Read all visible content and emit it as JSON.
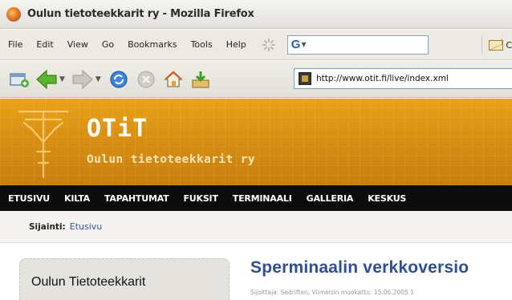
{
  "window": {
    "title": "Oulun tietoteekkarit ry - Mozilla Firefox"
  },
  "menubar": {
    "items": [
      "File",
      "Edit",
      "View",
      "Go",
      "Bookmarks",
      "Tools",
      "Help"
    ],
    "search_engine_icon": "google-g-icon",
    "mail_label": "C"
  },
  "navbar": {
    "buttons": [
      "new-window-icon",
      "back-icon",
      "forward-icon",
      "reload-icon",
      "stop-icon",
      "home-icon",
      "download-icon"
    ],
    "address": "http://www.otit.fi/live/index.xml"
  },
  "site": {
    "name": "OTiT",
    "subtitle": "Oulun tietoteekkarit ry",
    "header_color": "#e09a16",
    "nav": [
      "ETUSIVU",
      "KILTA",
      "TAPAHTUMAT",
      "FUKSIT",
      "TERMINAALI",
      "GALLERIA",
      "KESKUS"
    ]
  },
  "breadcrumb": {
    "label": "Sijainti:",
    "link": "Etusivu"
  },
  "sidebar": {
    "title": "Oulun Tietoteekkarit"
  },
  "article": {
    "title": "Sperminaalin verkkoversio",
    "meta": "Sijoittaja: Sedriften, Viimeisin muokattu: 15.06.2005 1"
  }
}
